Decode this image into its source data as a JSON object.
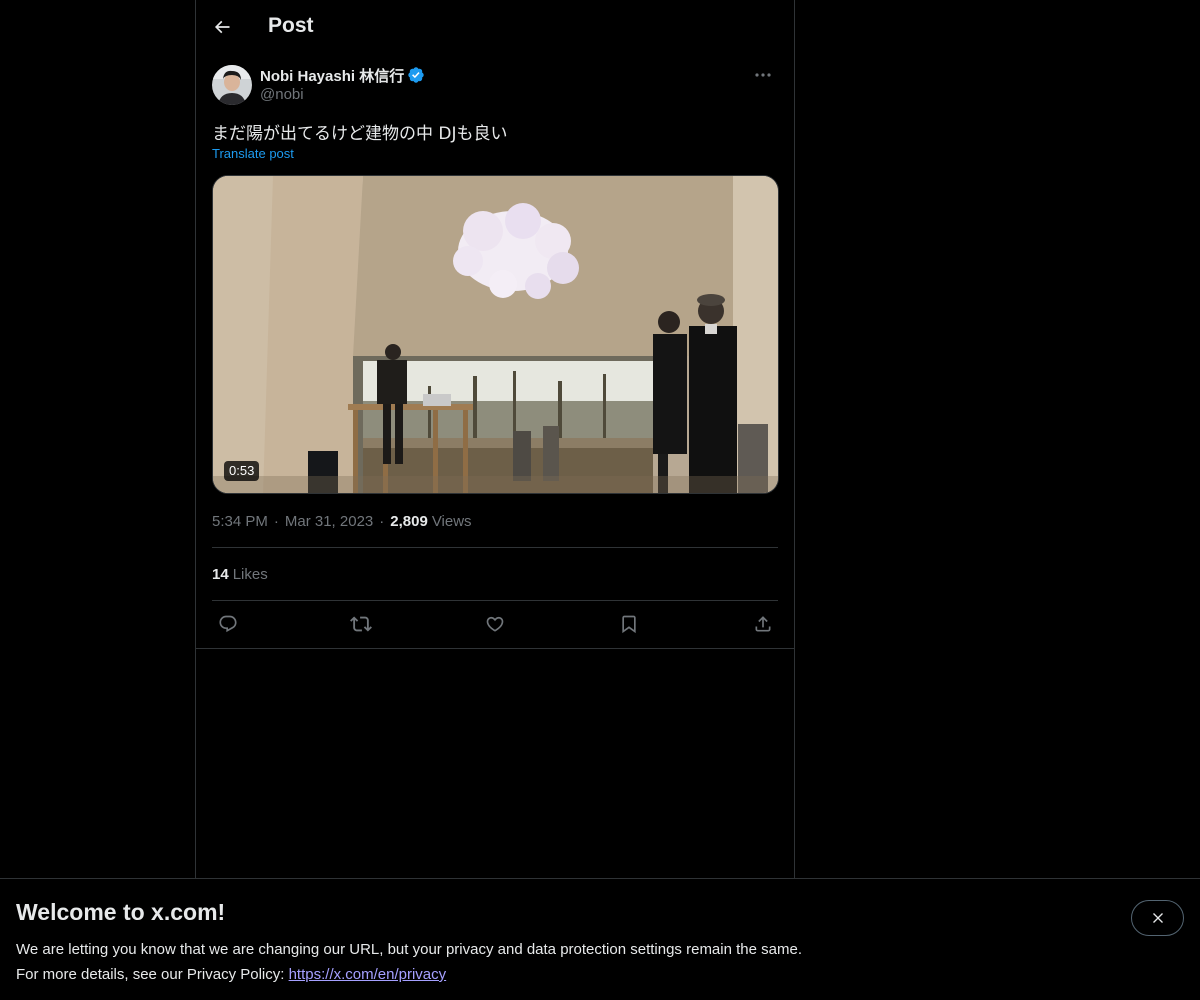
{
  "header": {
    "title": "Post"
  },
  "post": {
    "author": {
      "name": "Nobi Hayashi 林信行",
      "handle": "@nobi",
      "verified": true
    },
    "text": "まだ陽が出てるけど建物の中 DJも良い",
    "translate_label": "Translate post",
    "media": {
      "duration": "0:53"
    },
    "time": "5:34 PM",
    "date": "Mar 31, 2023",
    "separator": "·",
    "views_count": "2,809",
    "views_label": "Views",
    "likes_count": "14",
    "likes_label": "Likes"
  },
  "actions": {
    "icons": [
      "reply-icon",
      "repost-icon",
      "like-icon",
      "bookmark-icon",
      "share-icon"
    ]
  },
  "banner": {
    "title": "Welcome to x.com!",
    "line1": "We are letting you know that we are changing our URL, but your privacy and data protection settings remain the same.",
    "line2_prefix": "For more details, see our Privacy Policy: ",
    "link": "https://x.com/en/privacy"
  },
  "colors": {
    "background": "#000000",
    "text": "#e7e9ea",
    "secondary_text": "#71767b",
    "accent": "#1d9bf0",
    "border": "#2f3336",
    "link_visited": "#a5a0ff"
  }
}
